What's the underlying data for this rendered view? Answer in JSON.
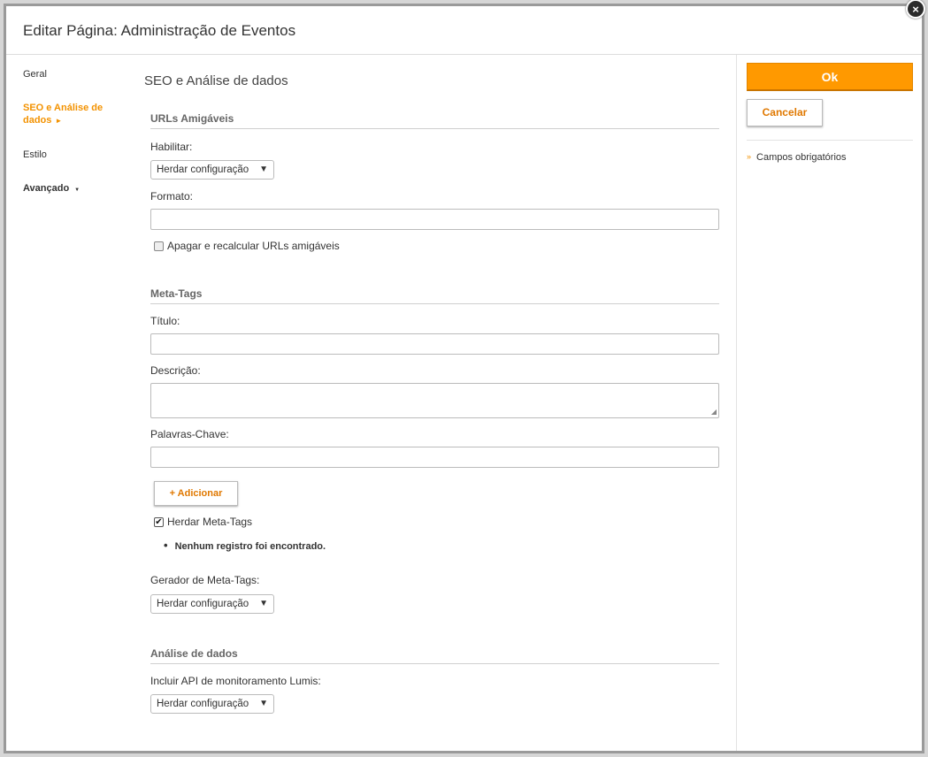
{
  "dialog": {
    "title": "Editar Página: Administração de Eventos",
    "close_icon": "×"
  },
  "nav": {
    "items": [
      {
        "label": "Geral"
      },
      {
        "label": "SEO e Análise de dados",
        "arrow": "►"
      },
      {
        "label": "Estilo"
      },
      {
        "label": "Avançado",
        "arrow": "▼"
      }
    ]
  },
  "content": {
    "heading": "SEO e Análise de dados",
    "friendly_urls": {
      "section_title": "URLs Amigáveis",
      "enable_label": "Habilitar:",
      "enable_value": "Herdar configuração",
      "format_label": "Formato:",
      "format_value": "",
      "recalc_checkbox_label": "Apagar e recalcular URLs amigáveis",
      "recalc_checked": false
    },
    "meta_tags": {
      "section_title": "Meta-Tags",
      "title_label": "Título:",
      "title_value": "",
      "description_label": "Descrição:",
      "description_value": "",
      "keywords_label": "Palavras-Chave:",
      "keywords_value": "",
      "add_button": "+ Adicionar",
      "inherit_checkbox_label": "Herdar Meta-Tags",
      "inherit_checked": true,
      "empty_message": "Nenhum registro foi encontrado.",
      "generator_label": "Gerador de Meta-Tags:",
      "generator_value": "Herdar configuração"
    },
    "analytics": {
      "section_title": "Análise de dados",
      "api_label": "Incluir API de monitoramento Lumis:",
      "api_value": "Herdar configuração"
    },
    "select_caret": "▼"
  },
  "actions": {
    "ok_label": "Ok",
    "cancel_label": "Cancelar",
    "required_note": "Campos obrigatórios",
    "required_marker": "»"
  },
  "colors": {
    "accent": "#f39200",
    "ok_button": "#ff9900"
  }
}
